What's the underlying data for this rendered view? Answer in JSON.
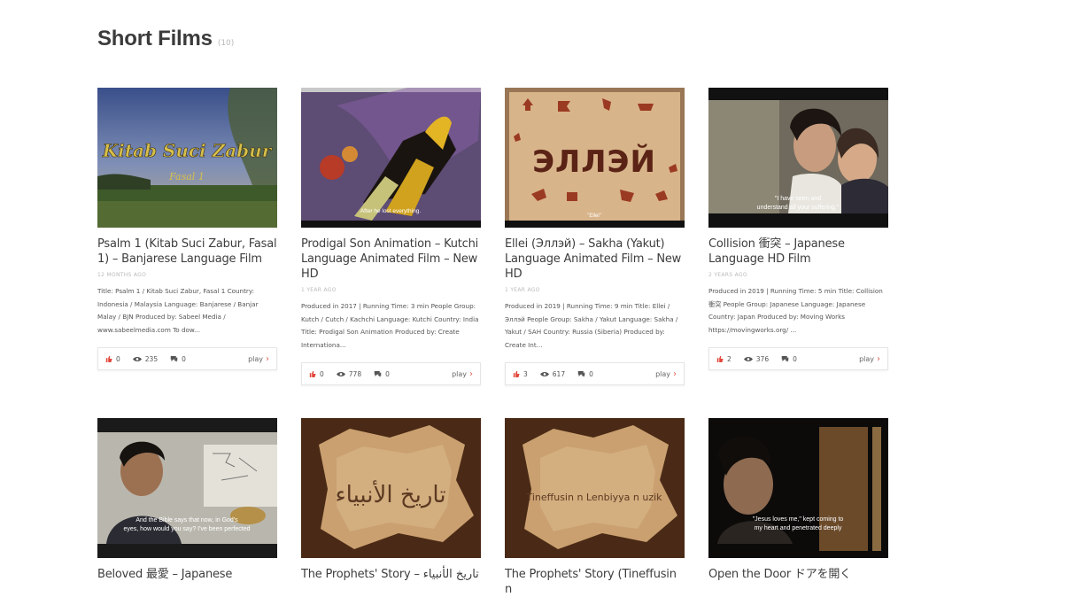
{
  "section": {
    "title": "Short Films",
    "count": "(10)"
  },
  "films": [
    {
      "title": "Psalm 1 (Kitab Suci Zabur, Fasal 1) – Banjarese Language Film",
      "date": "12 MONTHS AGO",
      "excerpt": "Title: Psalm 1 / Kitab Suci Zabur, Fasal 1 Country: Indonesia / Malaysia Language: Banjarese / Banjar Malay / BJN Produced by: Sabeel Media / www.sabeelmedia.com To dow...",
      "likes": "0",
      "views": "235",
      "comments": "0",
      "play": "play",
      "thumb_text": "Kitab Suci Zabur",
      "thumb_subtext": "Fasal 1"
    },
    {
      "title": "Prodigal Son Animation – Kutchi Language Animated Film – New HD",
      "date": "1 YEAR AGO",
      "excerpt": "Produced in 2017 | Running Time: 3 min People Group: Kutch / Cutch / Kachchi Language: Kutchi Country: India Title: Prodigal Son Animation Produced by: Create Internationa...",
      "likes": "0",
      "views": "778",
      "comments": "0",
      "play": "play",
      "thumb_caption": "After he lost everything."
    },
    {
      "title": "Ellei (Эллэй) – Sakha (Yakut) Language Animated Film – New HD",
      "date": "1 YEAR AGO",
      "excerpt": "Produced in 2019 | Running Time: 9 min Title: Ellei / Эллэй People Group: Sakha / Yakut Language: Sakha / Yakut / SAH Country: Russia (Siberia) Produced by: Create Int...",
      "likes": "3",
      "views": "617",
      "comments": "0",
      "play": "play",
      "thumb_text": "ЭЛЛЭЙ",
      "thumb_caption": "\"Ellei\""
    },
    {
      "title": "Collision 衝突 – Japanese Language HD Film",
      "date": "2 YEARS AGO",
      "excerpt": "Produced in 2019 | Running Time: 5 min Title: Collision 衝突 People Group: Japanese Language: Japanese Country: Japan Produced by: Moving Works https://movingworks.org/ ...",
      "likes": "2",
      "views": "376",
      "comments": "0",
      "play": "play",
      "thumb_caption": "\"I have seen and understand all your suffering.\""
    },
    {
      "title": "Beloved 最愛 – Japanese",
      "thumb_caption": "And the Bible says that now, in God's eyes, how would you say? I've been perfected"
    },
    {
      "title": "The Prophets' Story – تاريخ الأنبياء",
      "thumb_text": "تاريخ الأنبياء"
    },
    {
      "title": "The Prophets' Story (Tineffusin n",
      "thumb_text": "Tineffusin n Lenbiyya n uzik"
    },
    {
      "title": "Open the Door ドアを開く",
      "thumb_caption": "\"Jesus loves me,\" kept coming to my heart and penetrated deeply"
    }
  ],
  "icons": {
    "like": "thumbs-up-icon",
    "views": "eye-icon",
    "comments": "comment-bubble-icon",
    "play": "chevron-right-icon"
  },
  "colors": {
    "like": "#e2453a",
    "accent": "#e15b4b"
  }
}
